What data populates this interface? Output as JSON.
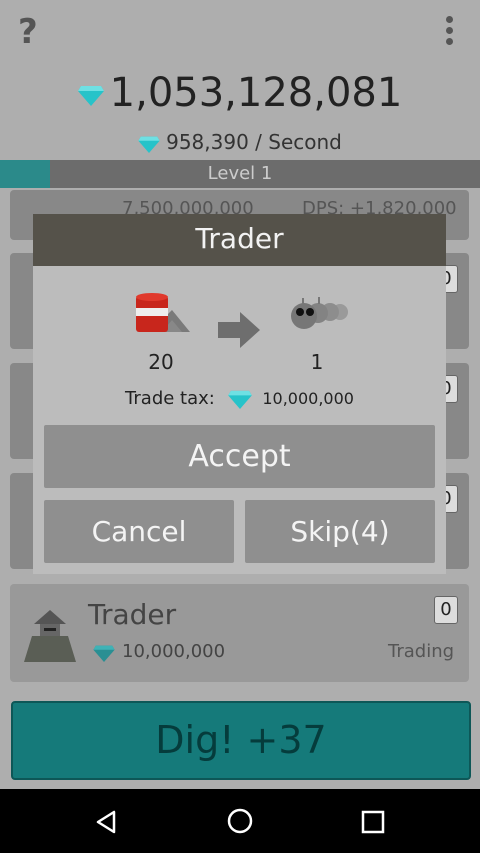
{
  "header": {
    "help_label": "?",
    "total_gems": "1,053,128,081",
    "gems_per_second": "958,390 / Second",
    "level_label": "Level 1"
  },
  "behind_rows": {
    "partial_left": "7,500,000,000",
    "partial_right": "DPS: +1,820,000",
    "row_right_values": [
      "0",
      "0",
      "0"
    ]
  },
  "trader_row": {
    "name": "Trader",
    "cost": "10,000,000",
    "status": "Trading",
    "count": "0"
  },
  "dig_button": {
    "label": "Dig! +37"
  },
  "dialog": {
    "title": "Trader",
    "give_amount": "20",
    "receive_amount": "1",
    "tax_label": "Trade tax:",
    "tax_value": "10,000,000",
    "accept_label": "Accept",
    "cancel_label": "Cancel",
    "skip_label": "Skip(4)"
  },
  "colors": {
    "accent": "#157a7a",
    "gem": "#27c3c9",
    "dialog_header": "#55524a",
    "button": "#8f8f8f"
  },
  "icons": [
    "help-icon",
    "overflow-menu-icon",
    "gem-icon",
    "barrel-ore-icon",
    "arrow-right-icon",
    "caterpillar-icon",
    "trader-icon",
    "back-icon",
    "home-icon",
    "recents-icon"
  ]
}
